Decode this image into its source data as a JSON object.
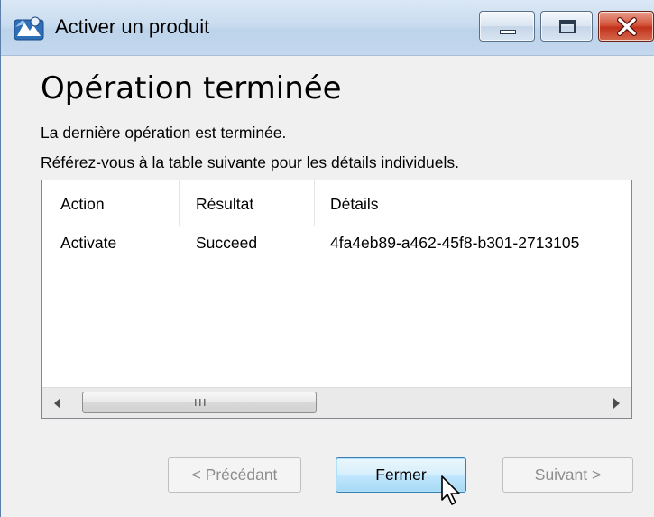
{
  "window": {
    "title": "Activer un produit",
    "controls": [
      "minimize",
      "maximize",
      "close"
    ]
  },
  "page": {
    "heading": "Opération terminée",
    "line1": "La dernière opération est terminée.",
    "line2": "Référez-vous à la table suivante pour les détails individuels."
  },
  "table": {
    "columns": [
      "Action",
      "Résultat",
      "Détails"
    ],
    "rows": [
      {
        "action": "Activate",
        "result": "Succeed",
        "details": "4fa4eb89-a462-45f8-b301-2713105"
      }
    ]
  },
  "buttons": {
    "previous": "< Précédant",
    "close": "Fermer",
    "next": "Suivant >"
  },
  "colors": {
    "accent": "#3c7fb1",
    "close_button": "#c2321b"
  }
}
